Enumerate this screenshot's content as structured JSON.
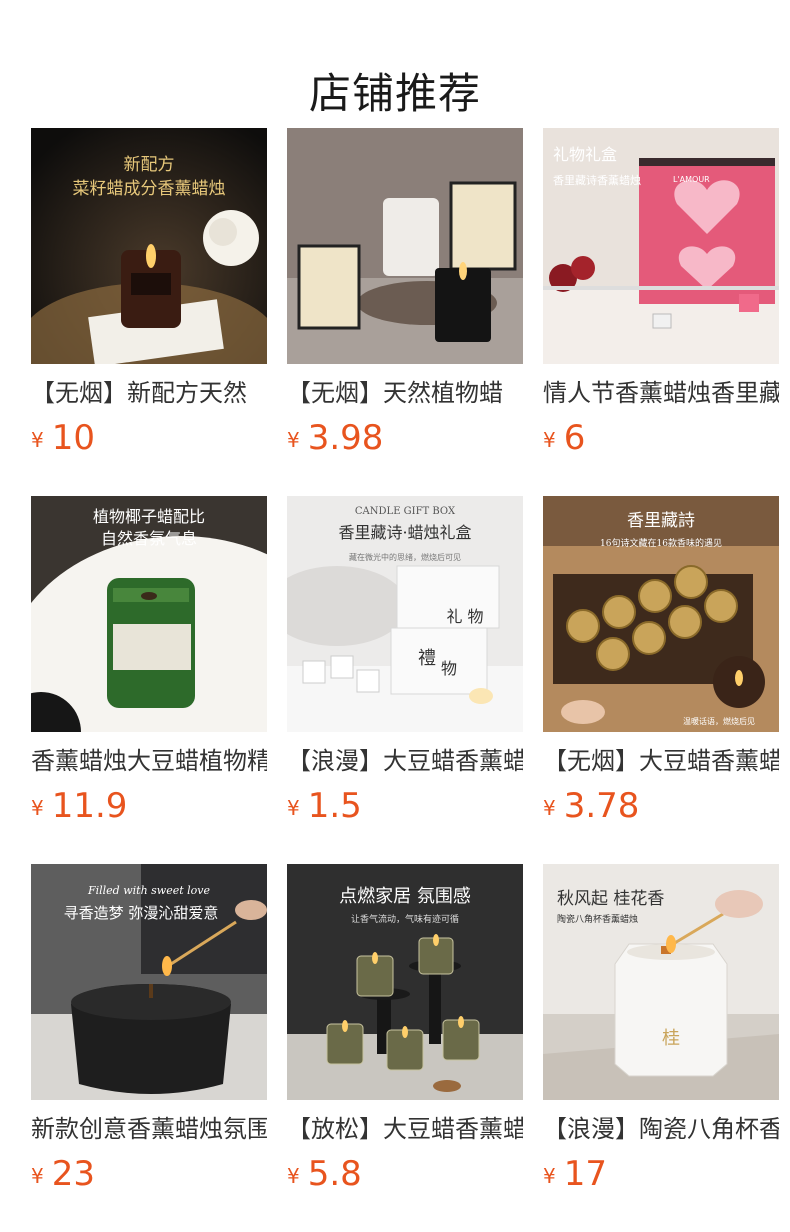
{
  "page": {
    "title": "店铺推荐"
  },
  "currency_symbol": "¥",
  "products": [
    {
      "title": "【无烟】新配方天然",
      "price": "10",
      "image_text": [
        "新配方",
        "菜籽蜡成分香薰蜡烛"
      ]
    },
    {
      "title": "【无烟】天然植物蜡",
      "price": "3.98",
      "image_text": []
    },
    {
      "title": "情人节香薰蜡烛香里藏",
      "price": "6",
      "image_text": [
        "礼物礼盒",
        "香里藏诗香薰蜡烛",
        "L'AMOUR"
      ]
    },
    {
      "title": "香薰蜡烛大豆蜡植物精",
      "price": "11.9",
      "image_text": [
        "植物椰子蜡配比",
        "自然香氛气息"
      ]
    },
    {
      "title": "【浪漫】大豆蜡香薰蜡",
      "price": "1.5",
      "image_text": [
        "CANDLE GIFT BOX",
        "香里藏诗·蜡烛礼盒",
        "藏在微光中的思绪，燃烧后可见",
        "礼 物",
        "禮",
        "物"
      ]
    },
    {
      "title": "【无烟】大豆蜡香薰蜡",
      "price": "3.78",
      "image_text": [
        "香里藏詩",
        "16句诗文藏在16款香味的遇见",
        "温暖话语，燃烧后见"
      ]
    },
    {
      "title": "新款创意香薰蜡烛氛围",
      "price": "23",
      "image_text": [
        "Filled with sweet love",
        "寻香造梦  弥漫沁甜爱意"
      ]
    },
    {
      "title": "【放松】大豆蜡香薰蜡",
      "price": "5.8",
      "image_text": [
        "点燃家居 氛围感",
        "让香气流动，气味有迹可循"
      ]
    },
    {
      "title": "【浪漫】陶瓷八角杯香",
      "price": "17",
      "image_text": [
        "秋风起 桂花香",
        "陶瓷八角杯香薰蜡烛",
        "桂"
      ]
    }
  ],
  "colors": {
    "price": "#e8541e",
    "title_text": "#333333",
    "heading": "#1a1a1a"
  }
}
